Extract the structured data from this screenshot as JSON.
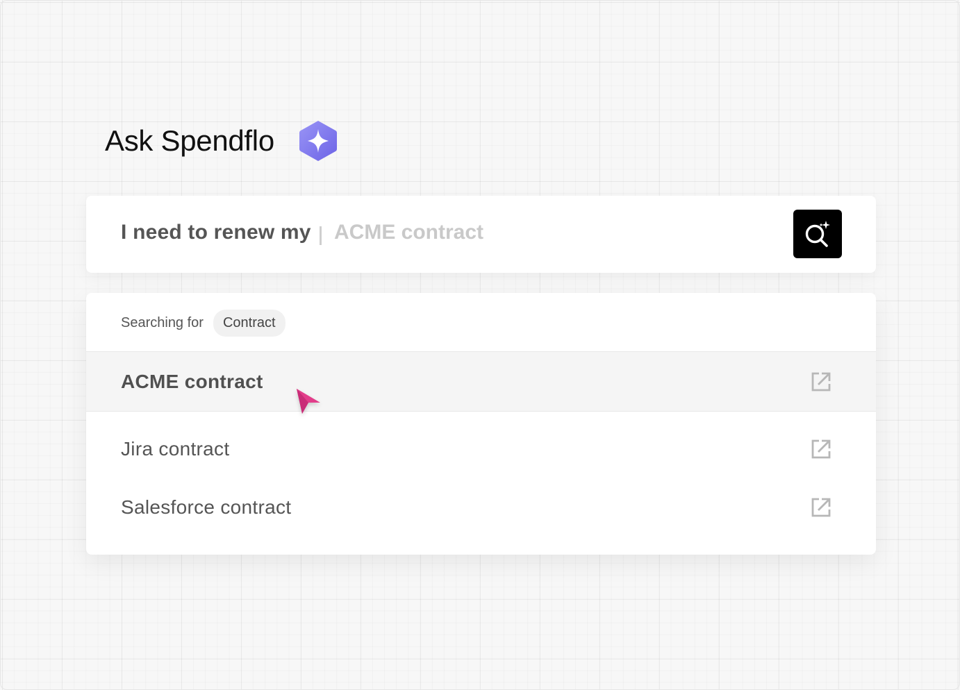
{
  "header": {
    "title": "Ask Spendflo",
    "logo_icon": "sparkle-hexagon-icon",
    "logo_colors": [
      "#8f89f3",
      "#7268e8"
    ]
  },
  "search": {
    "prefix": "I need to renew my",
    "value": "ACME contract",
    "button_icon": "ai-search-icon"
  },
  "results": {
    "searching_label": "Searching for",
    "category": "Contract",
    "items": [
      {
        "label": "ACME contract",
        "icon": "external-link-icon",
        "highlighted": true
      },
      {
        "label": "Jira contract",
        "icon": "external-link-icon",
        "highlighted": false
      },
      {
        "label": "Salesforce contract",
        "icon": "external-link-icon",
        "highlighted": false
      }
    ]
  },
  "cursor": {
    "icon": "pointer-cursor-icon",
    "color": "#e23d8a"
  }
}
